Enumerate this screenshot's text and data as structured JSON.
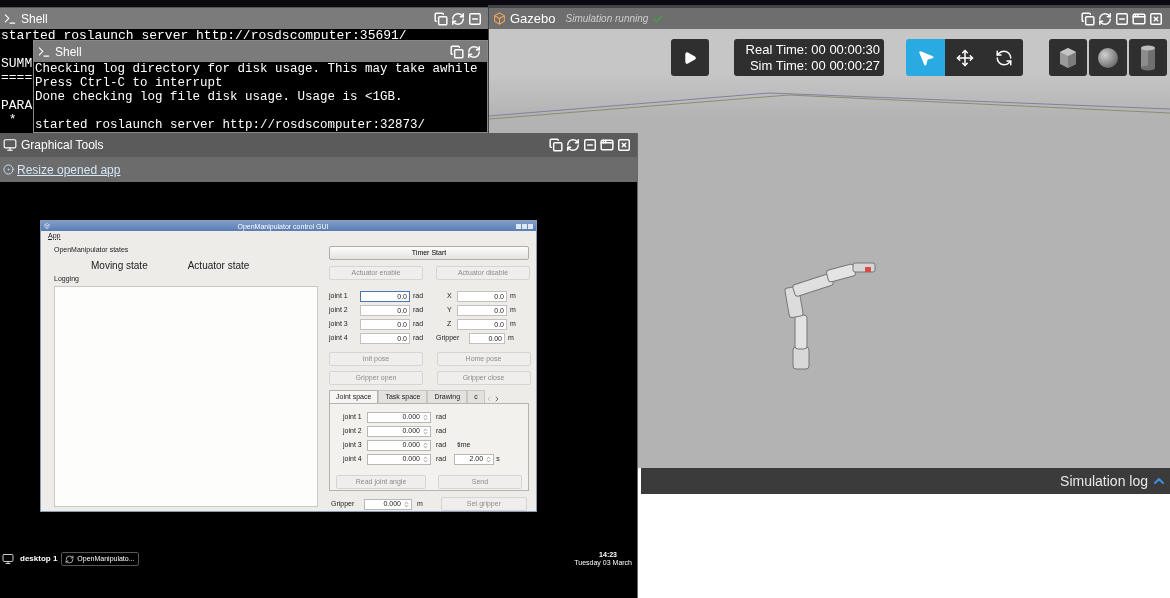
{
  "shell_back": {
    "title": "Shell",
    "blocks": [
      [
        "started roslaunch server http://rosdscomputer:35691/"
      ],
      [
        "SUMM",
        "===="
      ],
      [
        "PARA",
        " *"
      ]
    ]
  },
  "shell_front": {
    "title": "Shell",
    "blocks": [
      [
        "Checking log directory for disk usage. This may take awhile",
        "Press Ctrl-C to interrupt",
        "Done checking log file disk usage. Usage is <1GB."
      ],
      [
        "started roslaunch server http://rosdscomputer:32873/"
      ]
    ]
  },
  "graphical_tools": {
    "title": "Graphical Tools",
    "link": "Resize opened app",
    "app": {
      "title": "OpenManipulator control GUI",
      "menu": [
        "App"
      ],
      "states_title": "OpenManipulator states",
      "moving_state": "Moving state",
      "actuator_state": "Actuator state",
      "logging_label": "Logging",
      "timer_button": {
        "label": "Timer Start",
        "disabled": false
      },
      "actuator_buttons": [
        {
          "label": "Actuator enable",
          "disabled": true
        },
        {
          "label": "Actuator disable",
          "disabled": true
        }
      ],
      "joints": [
        {
          "label": "joint 1",
          "value": "0.0",
          "unit": "rad",
          "focused": true
        },
        {
          "label": "joint 2",
          "value": "0.0",
          "unit": "rad",
          "focused": false
        },
        {
          "label": "joint 3",
          "value": "0.0",
          "unit": "rad",
          "focused": false
        },
        {
          "label": "joint 4",
          "value": "0.0",
          "unit": "rad",
          "focused": false
        }
      ],
      "positions": [
        {
          "label": "X",
          "value": "0.0",
          "unit": "m"
        },
        {
          "label": "Y",
          "value": "0.0",
          "unit": "m"
        },
        {
          "label": "Z",
          "value": "0.0",
          "unit": "m"
        },
        {
          "label": "Gripper",
          "value": "0.00",
          "unit": "m"
        }
      ],
      "pose_buttons": [
        {
          "label": "Init pose",
          "disabled": true
        },
        {
          "label": "Home pose",
          "disabled": true
        },
        {
          "label": "Gripper open",
          "disabled": true
        },
        {
          "label": "Gripper close",
          "disabled": true
        }
      ],
      "tabs": [
        {
          "label": "Joint space",
          "selected": true
        },
        {
          "label": "Task space",
          "selected": false
        },
        {
          "label": "Drawing",
          "selected": false
        },
        {
          "label": "c",
          "selected": false
        }
      ],
      "joint_space": {
        "joints": [
          {
            "label": "joint 1",
            "value": "0.000",
            "unit": "rad"
          },
          {
            "label": "joint 2",
            "value": "0.000",
            "unit": "rad"
          },
          {
            "label": "joint 3",
            "value": "0.000",
            "unit": "rad"
          },
          {
            "label": "joint 4",
            "value": "0.000",
            "unit": "rad"
          }
        ],
        "time_label": "time",
        "time_value": "2.00",
        "time_unit": "s",
        "buttons": [
          {
            "label": "Read joint angle",
            "disabled": true
          },
          {
            "label": "Send",
            "disabled": true
          }
        ]
      },
      "gripper": {
        "label": "Gripper",
        "value": "0.000",
        "unit": "m"
      },
      "set_gripper_button": {
        "label": "Set gripper",
        "disabled": true
      }
    },
    "taskbar": {
      "desktop": "desktop 1",
      "apps": [
        "OpenManipulato..."
      ],
      "time": "14:23",
      "date": "Tuesday 03 March"
    }
  },
  "gazebo": {
    "title": "Gazebo",
    "status": "Simulation running",
    "real_time": "Real Time: 00 00:00:30",
    "sim_time": "Sim Time: 00 00:00:27",
    "tools": [
      {
        "kind": "select",
        "selected": true
      },
      {
        "kind": "translate",
        "selected": false
      },
      {
        "kind": "rotate",
        "selected": false
      }
    ],
    "shapes": [
      {
        "kind": "box"
      },
      {
        "kind": "sphere"
      },
      {
        "kind": "cylinder"
      }
    ],
    "log_label": "Simulation log"
  }
}
